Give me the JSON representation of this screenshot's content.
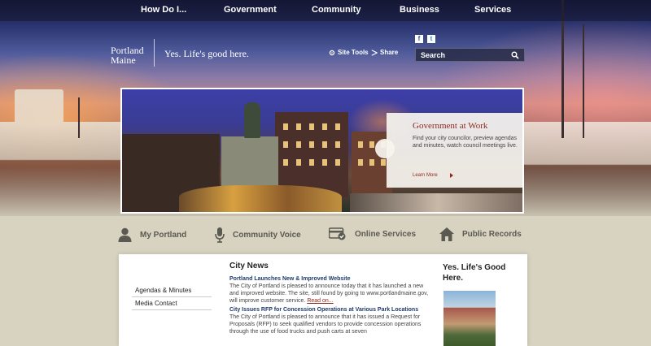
{
  "top_nav": {
    "items": [
      {
        "label": "How Do I..."
      },
      {
        "label": "Government"
      },
      {
        "label": "Community"
      },
      {
        "label": "Business"
      },
      {
        "label": "Services"
      }
    ]
  },
  "header": {
    "logo_line1": "Portland",
    "logo_line2": "Maine",
    "tagline": "Yes. Life's good here.",
    "site_tools_label": "Site Tools",
    "share_label": "Share",
    "social": {
      "facebook": "f",
      "twitter": "t"
    },
    "search": {
      "placeholder": "Search"
    }
  },
  "feature": {
    "title": "Government at Work",
    "body": "Find your city councilor, preview agendas and minutes, watch council meetings live.",
    "link_label": "Learn More"
  },
  "quick_links": [
    {
      "label": "My Portland",
      "icon": "person-icon"
    },
    {
      "label": "Community Voice",
      "icon": "microphone-icon"
    },
    {
      "label": "Online Services",
      "icon": "card-check-icon"
    },
    {
      "label": "Public Records",
      "icon": "house-icon"
    }
  ],
  "side_menu": {
    "items": [
      {
        "label": "Agendas & Minutes"
      },
      {
        "label": "Media Contact"
      }
    ]
  },
  "news": {
    "heading": "City News",
    "items": [
      {
        "title": "Portland Launches New & Improved Website",
        "body": "The City of Portland is pleased to announce today that it has launched a new and improved website. The site, still found by going to www.portlandmaine.gov, will improve customer service.",
        "read_on": "Read on..."
      },
      {
        "title": "City Issues RFP for Concession Operations at Various Park Locations",
        "body": "The City of Portland is pleased to announce that it has issued a Request for Proposals (RFP) to seek qualified vendors to provide concession operations through the use of food trucks and push carts at seven"
      }
    ]
  },
  "aside": {
    "heading": "Yes. Life's Good Here."
  },
  "colors": {
    "accent_red": "#8e2a1e",
    "news_title_blue": "#1e3a6a",
    "page_beige": "#d8d2c0"
  }
}
